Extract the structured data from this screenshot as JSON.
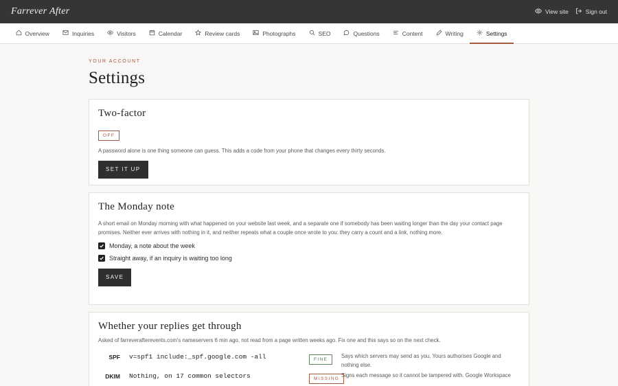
{
  "header": {
    "logo": "Farrever After",
    "view_site": "View site",
    "sign_out": "Sign out"
  },
  "nav": {
    "items": [
      {
        "label": "Overview",
        "icon": "home-icon"
      },
      {
        "label": "Inquiries",
        "icon": "mail-icon"
      },
      {
        "label": "Visitors",
        "icon": "eye-icon"
      },
      {
        "label": "Calendar",
        "icon": "calendar-icon"
      },
      {
        "label": "Review cards",
        "icon": "star-icon"
      },
      {
        "label": "Photographs",
        "icon": "image-icon"
      },
      {
        "label": "SEO",
        "icon": "search-icon"
      },
      {
        "label": "Questions",
        "icon": "chat-icon"
      },
      {
        "label": "Content",
        "icon": "lines-icon"
      },
      {
        "label": "Writing",
        "icon": "pencil-icon"
      },
      {
        "label": "Settings",
        "icon": "gear-icon"
      }
    ],
    "active": "Settings"
  },
  "page": {
    "eyebrow": "Your account",
    "title": "Settings"
  },
  "two_factor": {
    "title": "Two-factor",
    "status": "OFF",
    "description": "A password alone is one thing someone can guess. This adds a code from your phone that changes every thirty seconds.",
    "button": "Set it up"
  },
  "monday_note": {
    "title": "The Monday note",
    "description": "A short email on Monday morning with what happened on your website last week, and a separate one if somebody has been waiting longer than the day your contact page promises. Neither ever arrives with nothing in it, and neither repeats what a couple once wrote to you: they carry a count and a link, nothing more.",
    "options": [
      {
        "label": "Monday, a note about the week",
        "checked": true
      },
      {
        "label": "Straight away, if an inquiry is waiting too long",
        "checked": true
      }
    ],
    "button": "Save"
  },
  "replies": {
    "title": "Whether your replies get through",
    "description": "Asked of farreverafterevents.com's nameservers 6 min ago, not read from a page written weeks ago. Fix one and this says so on the next check.",
    "records": [
      {
        "label": "SPF",
        "value": "v=spf1 include:_spf.google.com -all",
        "status": "FINE",
        "note": "Says which servers may send as you. Yours authorises Google and nothing else."
      },
      {
        "label": "DKIM",
        "value": "Nothing, on 17 common selectors",
        "status": "MISSING",
        "note": "Signs each message so it cannot be tampered with. Google Workspace"
      }
    ]
  },
  "colors": {
    "accent": "#a35a3e",
    "topbar": "#353535",
    "ok": "#4d7a4d"
  }
}
